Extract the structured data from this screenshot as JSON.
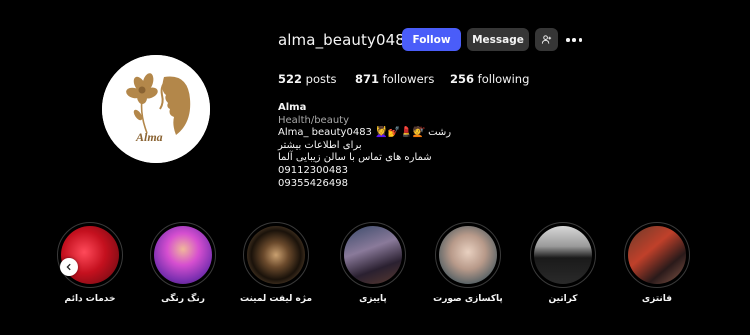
{
  "profile": {
    "username": "alma_beauty0483",
    "follow_label": "Follow",
    "message_label": "Message",
    "add_user_icon": "add-user-icon",
    "more_icon": "more-options-icon",
    "avatar_text": "Alma",
    "accent_color": "#4a5df9",
    "logo_color": "#b3874a"
  },
  "stats": {
    "posts_count": "522",
    "posts_label": "posts",
    "followers_count": "871",
    "followers_label": "followers",
    "following_count": "256",
    "following_label": "following"
  },
  "bio": {
    "name": "Alma",
    "category": "Health/beauty",
    "lines": [
      "Alma_ beauty0483 💆‍♀️💅💄💇 رشت",
      "برای اطلاعات بیشتر",
      "شماره های تماس با سالن زیبایی آلما",
      "09112300483",
      "09355426498"
    ]
  },
  "highlights": [
    {
      "label": "خدمات دائم"
    },
    {
      "label": "رنگ رنگی"
    },
    {
      "label": "مژه لیفت لمینت"
    },
    {
      "label": "پاییزی"
    },
    {
      "label": "پاکسازی صورت"
    },
    {
      "label": "کراتین"
    },
    {
      "label": "فانتزی"
    }
  ]
}
